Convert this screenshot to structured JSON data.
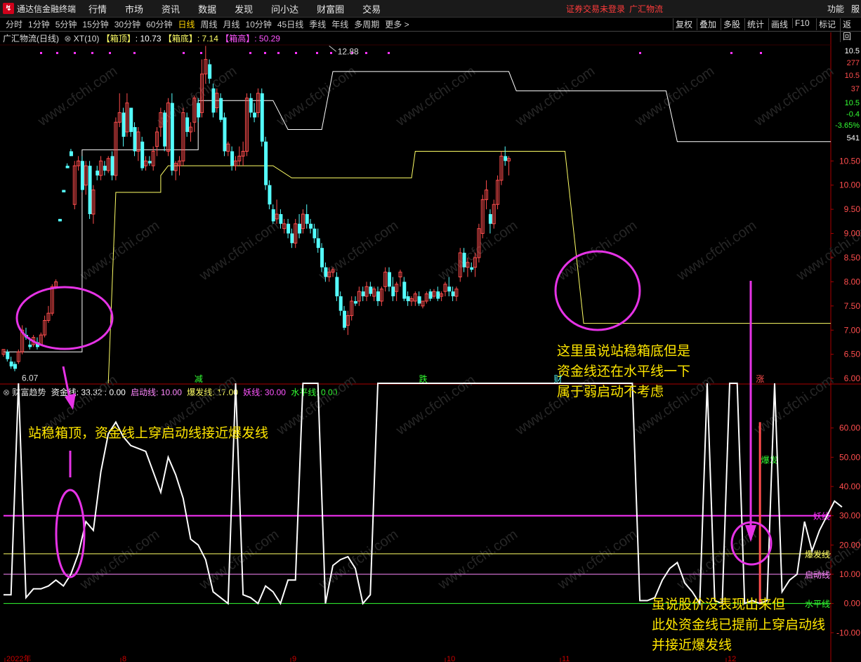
{
  "app": {
    "title": "通达信金融终端",
    "menu": [
      "行情",
      "市场",
      "资讯",
      "数据",
      "发现",
      "问小达",
      "财富圈",
      "交易"
    ],
    "login_status": "证券交易未登录",
    "stock_name": "广汇物流",
    "right_menu": [
      "功能",
      "服"
    ]
  },
  "toolbar": {
    "periods": [
      "分时",
      "1分钟",
      "5分钟",
      "15分钟",
      "30分钟",
      "60分钟",
      "日线",
      "周线",
      "月线",
      "10分钟",
      "45日线",
      "季线",
      "年线",
      "多周期",
      "更多 >"
    ],
    "active_period": "日线",
    "tools": [
      "复权",
      "叠加",
      "多股",
      "统计",
      "画线",
      "F10",
      "标记",
      "返回"
    ]
  },
  "price_panel": {
    "stock_label": "广汇物流(日线)",
    "indicator": "XT(10)",
    "box_top_label": "【箱顶】",
    "box_top_value": ": 10.73",
    "box_bottom_label": "【箱底】",
    "box_bottom_value": ": 7.14",
    "box_high_label": "【箱高】",
    "box_high_value": ": 50.29",
    "high_marker": "12.88",
    "low_marker": "6.07",
    "axis_ticks": [
      10.5,
      10.0,
      9.5,
      9.0,
      8.5,
      8.0,
      7.5,
      7.0,
      6.5,
      6.0
    ],
    "axis_ticks_text": [
      "10.50",
      "10.00",
      "9.50",
      "9.00",
      "8.50",
      "8.00",
      "7.50",
      "7.00",
      "6.50",
      "6.00"
    ],
    "quote_box": [
      "10.5",
      "277",
      "10.5",
      "37",
      "10.5",
      "-0.4",
      "-3.65%",
      "541"
    ],
    "signal_labels": [
      "减",
      "跌",
      "财",
      "涨"
    ],
    "ylim": [
      6.0,
      10.85
    ]
  },
  "indicator_panel": {
    "name": "财富趋势",
    "fund_line_label": "资金线: 33.32 : 0.00",
    "start_line_label": "启动线: 10.00",
    "burst_line_label": "爆发线: 17.00",
    "demon_line_label": "妖线: 30.00",
    "flat_line_label": "水平线: 0.00",
    "axis_ticks": [
      60,
      50,
      40,
      30,
      20,
      10,
      0,
      -10
    ],
    "axis_ticks_text": [
      "60.00",
      "50.00",
      "40.00",
      "30.00",
      "20.00",
      "10.00",
      "0.00",
      "-10.00"
    ],
    "ylim": [
      -20,
      70
    ],
    "line_tags": [
      "妖线",
      "爆发线",
      "启动线",
      "水平线"
    ],
    "burst_tag": "爆发",
    "date_axis": [
      "2022年",
      "8",
      "9",
      "10",
      "11",
      "12"
    ]
  },
  "annotations": {
    "left": "站稳箱顶，资金线上穿启动线接近爆发线",
    "middle": [
      "这里虽说站稳箱底但是",
      "资金线还在水平线一下",
      "属于弱启动不考虑"
    ],
    "bottom_right": [
      "虽说股价没表现出来但",
      "此处资金线已提前上穿启动线",
      "并接近爆发线"
    ]
  },
  "colors": {
    "up": "#ff4d4d",
    "down": "#54ffff",
    "box_top": "#ffffff",
    "box_bottom": "#ffff66",
    "fund_line": "#ffffff",
    "demon_line": "#ff33ff",
    "burst_line": "#ffff66",
    "start_line": "#ff88ff",
    "flat_line": "#33ff33",
    "annotation": "#ffe600",
    "ellipse": "#e633e6"
  },
  "watermark": "www.cfchi.com",
  "chart_data": {
    "type": "candlestick",
    "ohlc": [
      [
        6.5,
        6.6,
        6.45,
        6.6
      ],
      [
        6.55,
        6.6,
        6.35,
        6.4
      ],
      [
        6.35,
        6.45,
        6.2,
        6.25
      ],
      [
        6.3,
        6.35,
        6.15,
        6.2
      ],
      [
        6.35,
        6.6,
        6.3,
        6.55
      ],
      [
        6.55,
        7.1,
        6.5,
        7.0
      ],
      [
        6.9,
        7.05,
        6.8,
        6.85
      ],
      [
        6.7,
        6.85,
        6.6,
        6.65
      ],
      [
        6.7,
        6.9,
        6.65,
        6.85
      ],
      [
        6.75,
        6.85,
        6.6,
        6.65
      ],
      [
        6.7,
        6.95,
        6.7,
        6.9
      ],
      [
        6.9,
        7.3,
        6.85,
        7.2
      ],
      [
        7.2,
        7.5,
        7.15,
        7.35
      ],
      [
        7.35,
        7.95,
        7.3,
        7.9
      ],
      [
        7.9,
        8.05,
        7.85,
        8.0
      ],
      [
        9.3,
        9.3,
        9.25,
        9.25
      ],
      [
        9.9,
        9.9,
        9.85,
        9.85
      ],
      [
        10.4,
        10.45,
        10.35,
        10.35
      ],
      [
        10.7,
        10.75,
        10.6,
        10.6
      ],
      [
        9.6,
        10.5,
        9.5,
        10.4
      ],
      [
        10.4,
        10.6,
        10.3,
        10.5
      ],
      [
        10.5,
        10.6,
        9.85,
        9.9
      ],
      [
        10.0,
        10.5,
        9.8,
        10.4
      ],
      [
        10.4,
        10.5,
        9.3,
        9.4
      ],
      [
        9.4,
        10.0,
        9.2,
        9.9
      ],
      [
        10.3,
        10.4,
        10.1,
        10.2
      ],
      [
        10.2,
        10.6,
        10.1,
        10.5
      ],
      [
        10.4,
        10.5,
        10.2,
        10.3
      ],
      [
        10.3,
        10.6,
        10.25,
        10.55
      ],
      [
        10.6,
        10.7,
        10.1,
        10.2
      ],
      [
        10.2,
        11.4,
        10.1,
        11.3
      ],
      [
        11.3,
        11.9,
        11.2,
        11.5
      ],
      [
        11.5,
        11.6,
        10.8,
        11.0
      ],
      [
        11.1,
        11.9,
        11.0,
        11.7
      ],
      [
        11.6,
        11.6,
        11.0,
        11.1
      ],
      [
        11.2,
        11.3,
        10.6,
        10.7
      ],
      [
        10.7,
        11.2,
        10.5,
        11.1
      ],
      [
        10.9,
        11.0,
        10.3,
        10.35
      ],
      [
        10.4,
        10.6,
        10.3,
        10.5
      ],
      [
        10.5,
        10.6,
        10.4,
        10.45
      ],
      [
        10.4,
        10.8,
        10.3,
        10.7
      ],
      [
        10.8,
        11.2,
        10.6,
        11.1
      ],
      [
        11.2,
        11.6,
        11.0,
        11.5
      ],
      [
        11.5,
        11.55,
        10.7,
        10.8
      ],
      [
        10.7,
        11.8,
        10.6,
        11.7
      ],
      [
        11.7,
        11.9,
        10.2,
        10.3
      ],
      [
        10.3,
        10.5,
        10.1,
        10.45
      ],
      [
        10.4,
        10.6,
        10.2,
        10.5
      ],
      [
        10.5,
        11.6,
        10.4,
        11.5
      ],
      [
        11.4,
        11.5,
        11.0,
        11.1
      ],
      [
        11.1,
        11.3,
        10.9,
        11.2
      ],
      [
        11.3,
        11.85,
        11.1,
        11.8
      ],
      [
        11.7,
        11.8,
        11.3,
        11.4
      ],
      [
        11.5,
        12.6,
        11.4,
        12.3
      ],
      [
        12.3,
        12.88,
        12.1,
        12.6
      ],
      [
        12.5,
        12.6,
        12.1,
        12.2
      ],
      [
        12.0,
        12.1,
        11.4,
        11.5
      ],
      [
        11.6,
        12.0,
        11.5,
        11.9
      ],
      [
        11.8,
        11.9,
        11.3,
        11.35
      ],
      [
        11.4,
        11.5,
        10.6,
        10.7
      ],
      [
        10.7,
        10.9,
        10.6,
        10.85
      ],
      [
        10.7,
        10.8,
        10.3,
        10.4
      ],
      [
        10.4,
        10.6,
        10.3,
        10.5
      ],
      [
        10.5,
        10.8,
        10.4,
        10.6
      ],
      [
        10.6,
        10.9,
        10.4,
        10.7
      ],
      [
        10.7,
        11.9,
        10.6,
        11.8
      ],
      [
        11.8,
        11.9,
        11.4,
        11.5
      ],
      [
        11.5,
        11.7,
        11.3,
        11.4
      ],
      [
        11.5,
        12.0,
        11.4,
        11.9
      ],
      [
        11.9,
        12.0,
        10.8,
        10.9
      ],
      [
        10.9,
        11.0,
        9.9,
        10.0
      ],
      [
        10.0,
        10.1,
        9.5,
        9.6
      ],
      [
        9.5,
        9.6,
        9.2,
        9.25
      ],
      [
        9.3,
        9.7,
        9.2,
        9.4
      ],
      [
        9.4,
        9.5,
        9.1,
        9.2
      ],
      [
        9.1,
        9.3,
        9.0,
        9.2
      ],
      [
        9.2,
        9.3,
        8.9,
        9.0
      ],
      [
        9.0,
        9.1,
        8.7,
        8.8
      ],
      [
        8.8,
        9.3,
        8.7,
        9.2
      ],
      [
        9.2,
        9.4,
        8.9,
        9.0
      ],
      [
        9.1,
        9.5,
        9.0,
        9.4
      ],
      [
        9.4,
        9.6,
        9.1,
        9.2
      ],
      [
        9.2,
        9.3,
        9.0,
        9.1
      ],
      [
        9.1,
        9.2,
        8.8,
        8.9
      ],
      [
        8.9,
        9.1,
        8.6,
        8.7
      ],
      [
        8.7,
        8.8,
        8.2,
        8.3
      ],
      [
        8.3,
        8.4,
        8.0,
        8.1
      ],
      [
        8.1,
        8.3,
        8.0,
        8.2
      ],
      [
        8.2,
        8.3,
        8.1,
        8.25
      ],
      [
        8.1,
        8.2,
        7.6,
        7.7
      ],
      [
        7.7,
        7.8,
        7.3,
        7.4
      ],
      [
        7.4,
        7.5,
        7.0,
        7.05
      ],
      [
        7.1,
        7.4,
        6.9,
        7.3
      ],
      [
        7.3,
        7.7,
        7.2,
        7.6
      ],
      [
        7.6,
        7.7,
        7.5,
        7.55
      ],
      [
        7.6,
        7.9,
        7.5,
        7.8
      ],
      [
        7.8,
        7.9,
        7.6,
        7.7
      ],
      [
        7.7,
        8.0,
        7.6,
        7.9
      ],
      [
        7.9,
        8.0,
        7.7,
        7.75
      ],
      [
        7.7,
        7.9,
        7.6,
        7.85
      ],
      [
        7.8,
        7.9,
        7.5,
        7.6
      ],
      [
        7.6,
        7.9,
        7.5,
        7.85
      ],
      [
        7.9,
        8.3,
        7.8,
        8.2
      ],
      [
        8.2,
        8.3,
        7.8,
        7.9
      ],
      [
        7.9,
        8.1,
        7.6,
        7.7
      ],
      [
        7.8,
        8.0,
        7.6,
        7.95
      ],
      [
        8.1,
        8.25,
        7.9,
        8.2
      ],
      [
        8.0,
        8.1,
        7.6,
        7.65
      ],
      [
        7.7,
        7.8,
        7.5,
        7.6
      ],
      [
        7.6,
        7.7,
        7.5,
        7.65
      ],
      [
        7.6,
        7.8,
        7.5,
        7.75
      ],
      [
        7.7,
        7.8,
        7.5,
        7.55
      ],
      [
        7.5,
        7.6,
        7.45,
        7.6
      ],
      [
        7.6,
        7.8,
        7.55,
        7.75
      ],
      [
        7.8,
        7.85,
        7.6,
        7.65
      ],
      [
        7.7,
        7.85,
        7.65,
        7.8
      ],
      [
        7.8,
        7.9,
        7.6,
        7.65
      ],
      [
        7.7,
        7.8,
        7.6,
        7.75
      ],
      [
        7.8,
        8.0,
        7.7,
        7.95
      ],
      [
        7.9,
        8.1,
        7.7,
        7.8
      ],
      [
        7.8,
        7.9,
        7.6,
        7.7
      ],
      [
        7.7,
        7.9,
        7.6,
        7.85
      ],
      [
        8.1,
        8.7,
        8.0,
        8.6
      ],
      [
        8.6,
        8.7,
        8.2,
        8.3
      ],
      [
        8.3,
        8.5,
        8.1,
        8.4
      ],
      [
        8.3,
        8.4,
        8.2,
        8.25
      ],
      [
        8.3,
        8.6,
        8.1,
        8.5
      ],
      [
        8.5,
        9.2,
        8.4,
        9.1
      ],
      [
        9.0,
        9.8,
        8.9,
        9.7
      ],
      [
        9.7,
        10.1,
        9.5,
        9.9
      ],
      [
        9.4,
        9.5,
        9.0,
        9.2
      ],
      [
        9.2,
        9.7,
        9.1,
        9.6
      ],
      [
        9.6,
        10.2,
        9.5,
        10.1
      ],
      [
        10.1,
        10.7,
        10.0,
        10.6
      ],
      [
        10.6,
        10.8,
        10.4,
        10.5
      ],
      [
        10.5,
        10.6,
        10.2,
        10.55
      ]
    ],
    "box_top": [
      [
        1,
        6.55
      ],
      [
        22,
        6.55
      ],
      [
        22,
        10.73
      ],
      [
        53,
        10.73
      ],
      [
        53,
        11.75
      ],
      [
        73,
        11.75
      ],
      [
        77,
        11.15
      ],
      [
        86,
        11.15
      ],
      [
        89,
        12.35
      ],
      [
        136,
        12.35
      ],
      [
        138,
        11.95
      ],
      [
        176,
        11.95
      ],
      [
        178,
        11.95
      ],
      [
        181,
        10.9
      ],
      [
        222,
        10.9
      ]
    ],
    "box_bottom": [
      [
        29,
        -1
      ],
      [
        31,
        9.85
      ],
      [
        43,
        9.85
      ],
      [
        43,
        10.2
      ],
      [
        45,
        10.4
      ],
      [
        73,
        10.4
      ],
      [
        78,
        10.15
      ],
      [
        90,
        10.15
      ],
      [
        110,
        10.15
      ],
      [
        111,
        10.7
      ],
      [
        151,
        10.7
      ],
      [
        156,
        7.14
      ],
      [
        222,
        7.14
      ]
    ],
    "fund_line": [
      [
        1,
        3
      ],
      [
        3,
        3
      ],
      [
        5,
        -1
      ],
      [
        7,
        2
      ],
      [
        9,
        5
      ],
      [
        11,
        5
      ],
      [
        13,
        6
      ],
      [
        15,
        8
      ],
      [
        17,
        6
      ],
      [
        19,
        10
      ],
      [
        21,
        17
      ],
      [
        23,
        28
      ],
      [
        25,
        25
      ],
      [
        27,
        45
      ],
      [
        29,
        58
      ],
      [
        31,
        62
      ],
      [
        33,
        57
      ],
      [
        35,
        54
      ],
      [
        37,
        53
      ],
      [
        39,
        52
      ],
      [
        41,
        45
      ],
      [
        43,
        38
      ],
      [
        45,
        50
      ],
      [
        47,
        44
      ],
      [
        49,
        36
      ],
      [
        51,
        22
      ],
      [
        53,
        20
      ],
      [
        55,
        15
      ],
      [
        57,
        4
      ],
      [
        59,
        2
      ],
      [
        61,
        0
      ],
      [
        63,
        -1
      ],
      [
        65,
        3
      ],
      [
        67,
        2
      ],
      [
        69,
        0
      ],
      [
        71,
        6
      ],
      [
        73,
        4
      ],
      [
        75,
        0
      ],
      [
        77,
        8
      ],
      [
        79,
        8
      ],
      [
        81,
        -10
      ],
      [
        83,
        -13
      ],
      [
        85,
        -6
      ],
      [
        87,
        0
      ],
      [
        89,
        13
      ],
      [
        91,
        15
      ],
      [
        93,
        16
      ],
      [
        95,
        12
      ],
      [
        97,
        0
      ],
      [
        99,
        3
      ],
      [
        101,
        -5
      ],
      [
        103,
        -9
      ],
      [
        105,
        -8
      ],
      [
        107,
        -10
      ],
      [
        109,
        -3
      ],
      [
        111,
        -5
      ],
      [
        113,
        -12
      ],
      [
        115,
        -17
      ],
      [
        117,
        -17
      ],
      [
        119,
        -18
      ],
      [
        121,
        -16
      ],
      [
        123,
        -17
      ],
      [
        125,
        -18
      ],
      [
        127,
        -17
      ],
      [
        129,
        -22
      ],
      [
        131,
        -18
      ],
      [
        133,
        -15
      ],
      [
        135,
        -20
      ],
      [
        137,
        -17
      ],
      [
        139,
        -20
      ],
      [
        141,
        -19
      ],
      [
        143,
        -20
      ],
      [
        145,
        -18
      ],
      [
        147,
        -15
      ],
      [
        149,
        -14
      ],
      [
        151,
        -12
      ],
      [
        153,
        -15
      ],
      [
        155,
        -25
      ],
      [
        157,
        -20
      ],
      [
        159,
        -20
      ],
      [
        161,
        -16
      ],
      [
        163,
        -12
      ],
      [
        165,
        -8
      ],
      [
        167,
        -5
      ],
      [
        169,
        -3
      ],
      [
        171,
        1
      ],
      [
        173,
        1
      ],
      [
        175,
        2
      ],
      [
        177,
        8
      ],
      [
        179,
        12
      ],
      [
        181,
        14
      ],
      [
        183,
        7
      ],
      [
        185,
        4
      ],
      [
        187,
        0
      ],
      [
        189,
        -2
      ],
      [
        191,
        1
      ],
      [
        193,
        0
      ],
      [
        195,
        -3
      ],
      [
        197,
        -2
      ],
      [
        199,
        0
      ],
      [
        201,
        1
      ],
      [
        203,
        0
      ],
      [
        205,
        1
      ],
      [
        207,
        -1
      ],
      [
        209,
        4
      ],
      [
        211,
        8
      ],
      [
        213,
        10
      ],
      [
        215,
        28
      ],
      [
        217,
        18
      ],
      [
        219,
        25
      ],
      [
        221,
        30
      ],
      [
        223,
        35
      ],
      [
        225,
        33
      ]
    ],
    "fund_line_last": 33.32
  }
}
